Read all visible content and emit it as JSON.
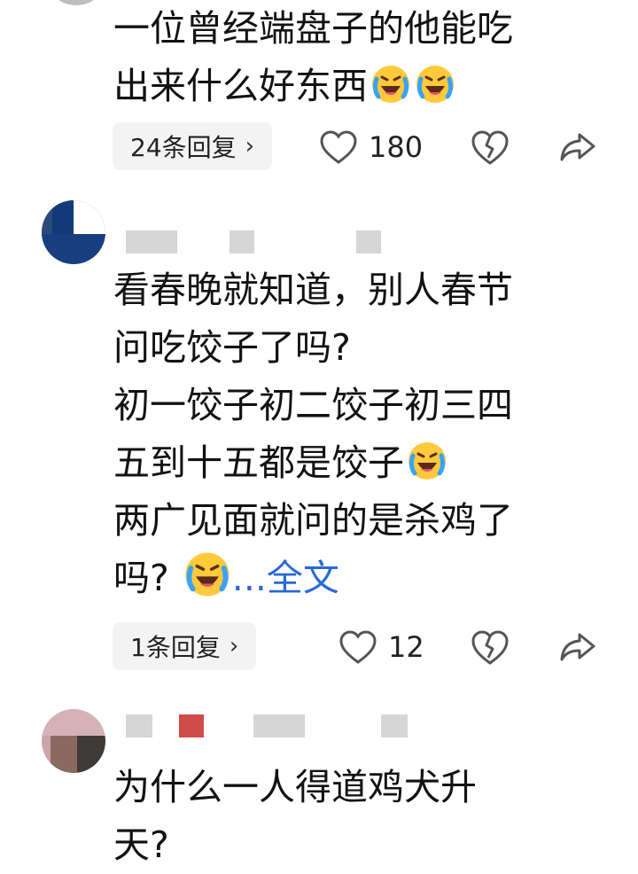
{
  "comments": [
    {
      "text_lines": [
        "一位曾经端盘子的他能吃",
        "出来什么好东西"
      ],
      "emoji": "laughing-crying-emoji",
      "reply_label": "24条回复",
      "like_count": "180"
    },
    {
      "text_lines": [
        "看春晚就知道，别人春节",
        "问吃饺子了吗?",
        "初一饺子初二饺子初三四",
        "五到十五都是饺子",
        "两广见面就问的是杀鸡了",
        "吗? "
      ],
      "more_link": "...全文",
      "emoji": "laughing-crying-emoji",
      "reply_label": "1条回复",
      "like_count": "12"
    },
    {
      "text_lines": [
        "为什么一人得道鸡犬升",
        "天?"
      ]
    }
  ],
  "icons": {
    "like": "heart-outline-icon",
    "dislike": "broken-heart-icon",
    "share": "share-arrow-icon",
    "chevron": "chevron-right-icon"
  },
  "colors": {
    "link": "#2a69d6",
    "pill_bg": "#f3f3f3",
    "icon": "#555555"
  }
}
